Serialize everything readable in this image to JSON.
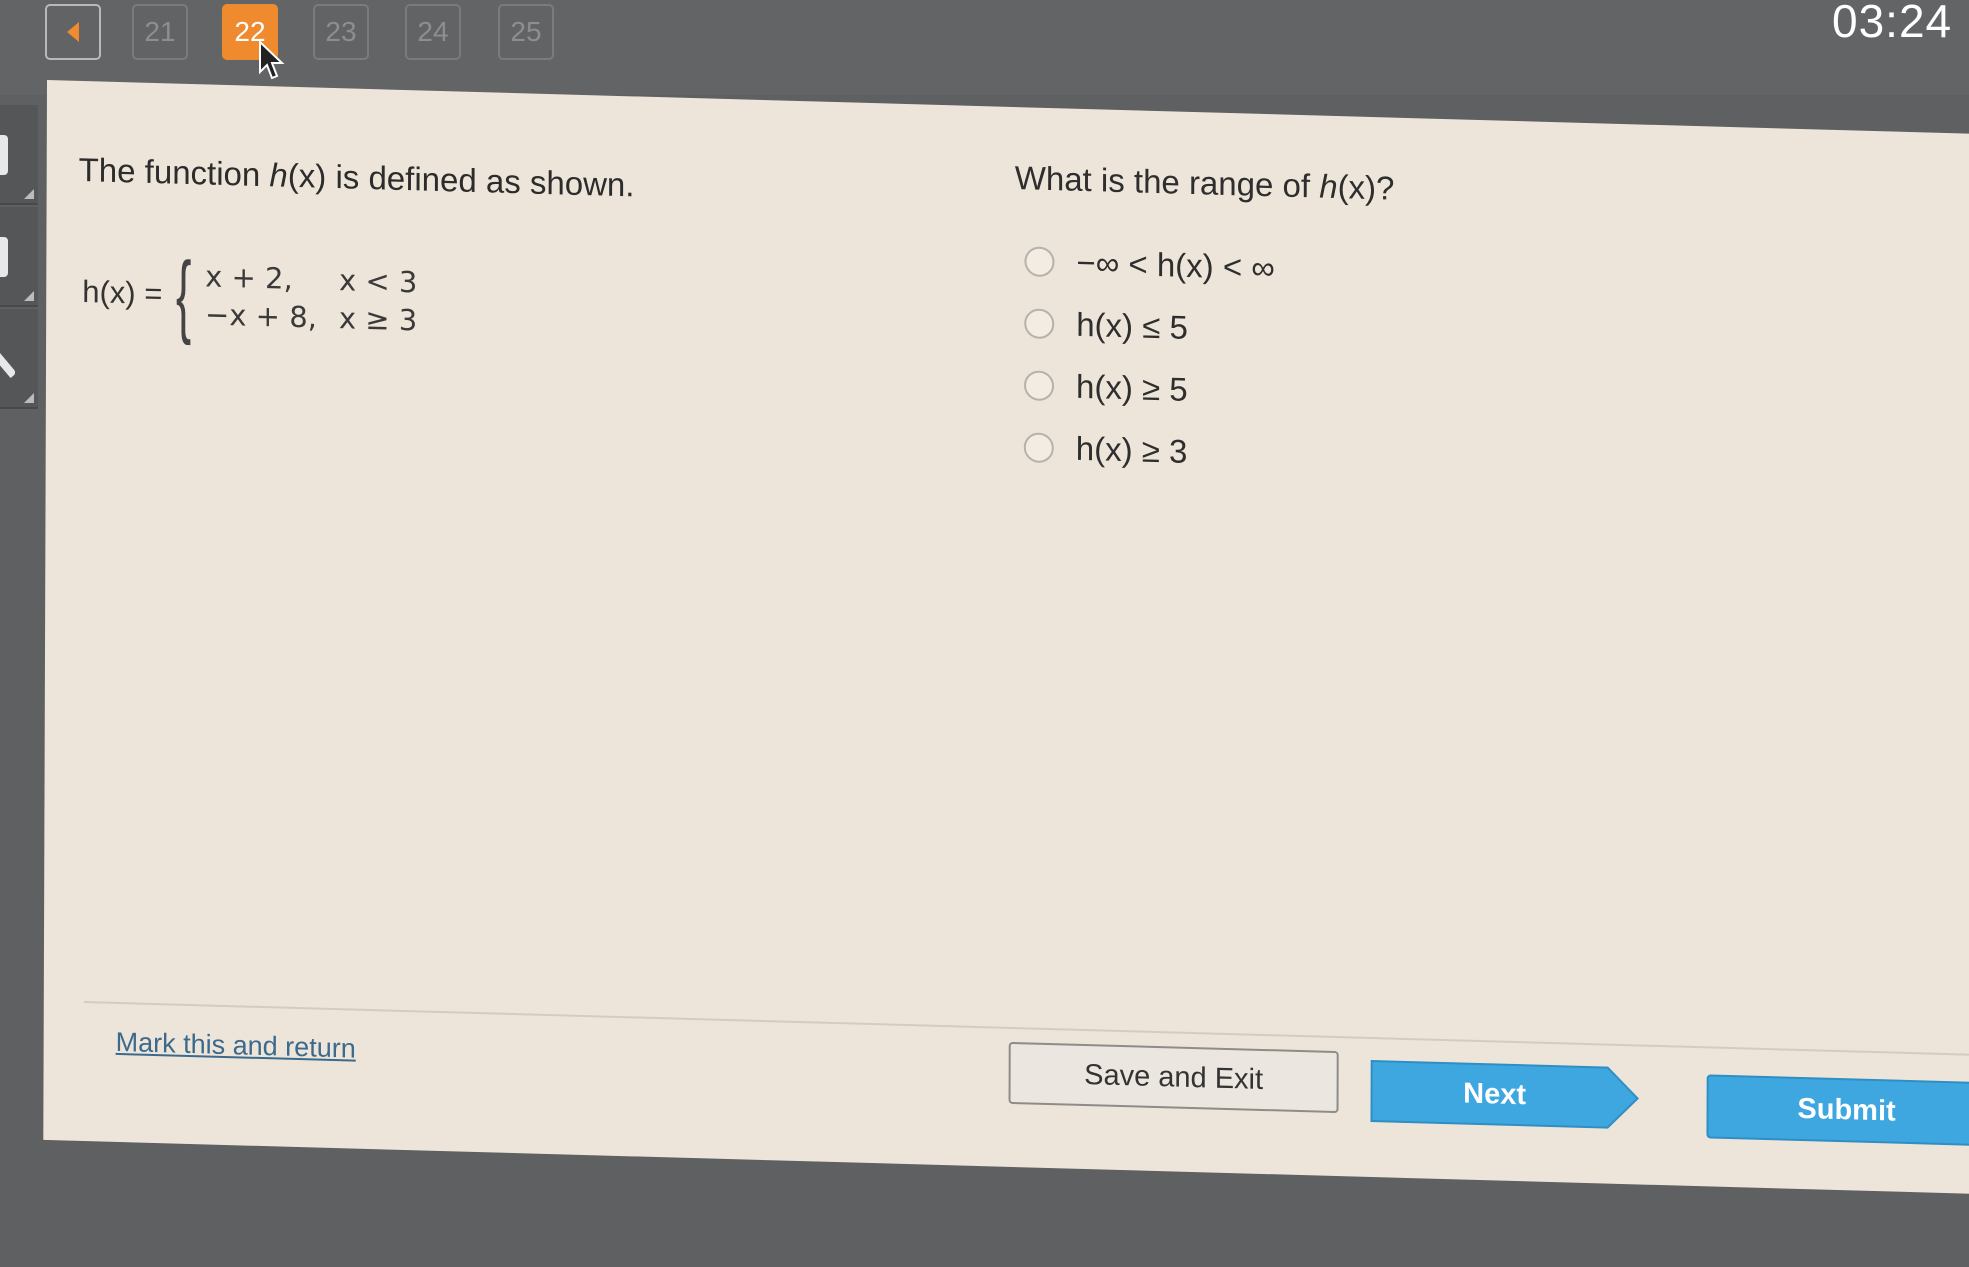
{
  "nav": {
    "back_icon": "left-arrow-icon",
    "questions": [
      {
        "number": "21",
        "active": false
      },
      {
        "number": "22",
        "active": true
      },
      {
        "number": "23",
        "active": false
      },
      {
        "number": "24",
        "active": false
      },
      {
        "number": "25",
        "active": false
      }
    ],
    "timer": "03:24"
  },
  "sidebar": {
    "tools": [
      "tool-1",
      "tool-2",
      "tool-3"
    ]
  },
  "question": {
    "stem": {
      "pre": "The function ",
      "fn": "h",
      "fn_arg": "(x)",
      "post": " is defined as shown."
    },
    "definition": {
      "lhs": "h(x) =",
      "cases": [
        {
          "expr": "x + 2,",
          "cond": "x < 3"
        },
        {
          "expr": "−x + 8,",
          "cond": "x ≥ 3"
        }
      ]
    },
    "prompt": {
      "pre": "What is the range of ",
      "fn": "h",
      "fn_arg": "(x)",
      "post": "?"
    },
    "options": [
      {
        "label": "−∞ < h(x) < ∞",
        "selected": false
      },
      {
        "label": "h(x) ≤ 5",
        "selected": false
      },
      {
        "label": "h(x) ≥ 5",
        "selected": false
      },
      {
        "label": "h(x) ≥ 3",
        "selected": false
      }
    ]
  },
  "footer": {
    "mark_link": "Mark this and return",
    "save_exit": "Save and Exit",
    "next": "Next",
    "submit": "Submit"
  },
  "colors": {
    "active_question": "#f08a2e",
    "primary_button": "#3ea7e0",
    "link": "#3c6a8c",
    "panel_bg": "#ede5da"
  }
}
